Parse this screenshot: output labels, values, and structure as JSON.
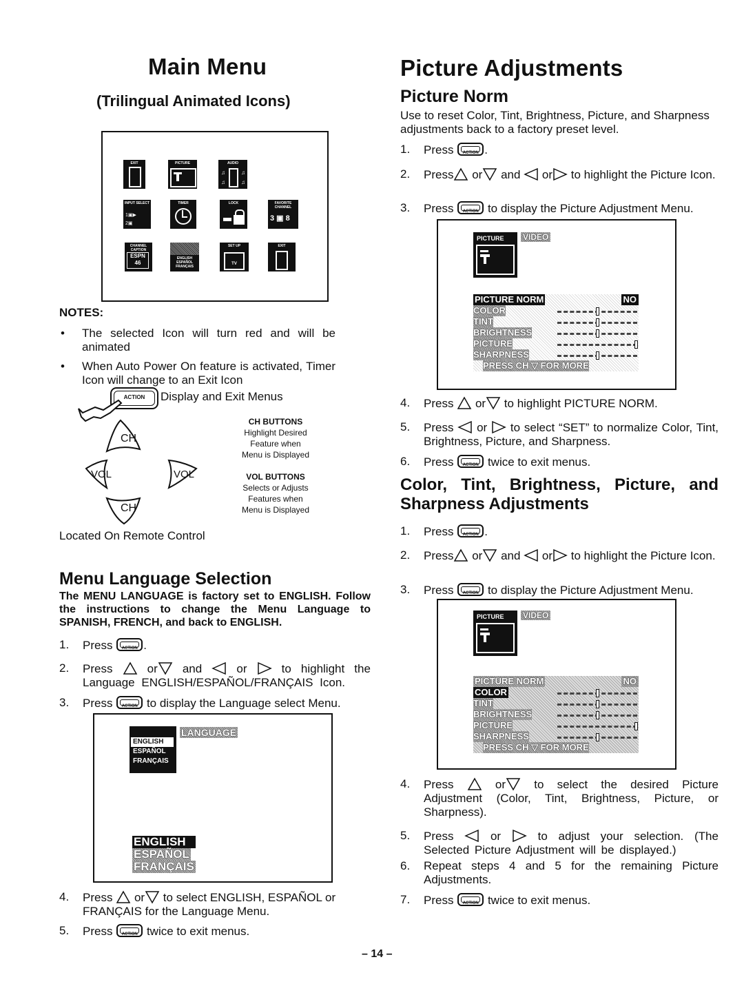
{
  "left": {
    "title": "Main Menu",
    "subtitle": "(Trilingual Animated Icons)",
    "icons": [
      {
        "label": "EXIT"
      },
      {
        "label": "PICTURE"
      },
      {
        "label": "AUDIO"
      },
      {
        "label": "INPUT SELECT"
      },
      {
        "label": "TIMER"
      },
      {
        "label": "LOCK"
      },
      {
        "label": "FAVORITE CHANNEL"
      },
      {
        "label": "CHANNEL CAPTION",
        "sub": "ESPN 46"
      },
      {
        "label": "ENGLISH ESPAÑOL FRANÇAIS"
      },
      {
        "label": "SET UP",
        "sub": "TV"
      },
      {
        "label": "EXIT"
      }
    ],
    "notes_heading": "NOTES:",
    "notes": [
      "The selected Icon will turn red and will be animated",
      "When Auto Power On feature is activated, Timer Icon will change to an Exit Icon"
    ],
    "action_label": "ACTION",
    "action_desc": "Display and Exit Menus",
    "ch_label": "CH",
    "vol_label": "VOL",
    "ch_buttons_title": "CH BUTTONS",
    "ch_buttons_desc": [
      "Highlight Desired",
      "Feature when",
      "Menu is Displayed"
    ],
    "vol_buttons_title": "VOL BUTTONS",
    "vol_buttons_desc": [
      "Selects or Adjusts",
      "Features when",
      "Menu is Displayed"
    ],
    "remote_caption": "Located On Remote Control",
    "lang_title": "Menu Language Selection",
    "lang_intro": "The MENU LANGUAGE is factory set to ENGLISH. Follow the instructions to change the Menu Language to SPANISH, FRENCH, and back to ENGLISH.",
    "lang_steps": {
      "s1_num": "1.",
      "s1_pre": "Press",
      "s1_post": ".",
      "s2_num": "2.",
      "s2_pre": "Press",
      "s2_or1": "or",
      "s2_and": "and",
      "s2_or2": "or",
      "s2_post": "to highlight the Language ENGLISH/ESPAÑOL/FRANÇAIS Icon.",
      "s3_num": "3.",
      "s3_pre": "Press",
      "s3_post": "to display the Language select Menu.",
      "s4_num": "4.",
      "s4_pre": "Press",
      "s4_or": "or",
      "s4_post": "to select ENGLISH, ESPAÑOL or FRANÇAIS for the Language Menu.",
      "s5_num": "5.",
      "s5_pre": "Press",
      "s5_post": "twice to exit menus."
    },
    "lang_screen": {
      "menu_items": [
        "ENGLISH",
        "ESPAÑOL",
        "FRANÇAIS"
      ],
      "header": "LANGUAGE",
      "list": [
        "ENGLISH",
        "ESPAÑOL",
        "FRANÇAIS"
      ]
    }
  },
  "right": {
    "title": "Picture Adjustments",
    "norm_title": "Picture Norm",
    "norm_intro": "Use to reset Color, Tint, Brightness, Picture, and Sharpness adjustments back to a factory preset level.",
    "norm_steps": {
      "s1_num": "1.",
      "s1_pre": "Press",
      "s1_post": ".",
      "s2_num": "2.",
      "s2_pre": "Press",
      "s2_or1": "or",
      "s2_and": "and",
      "s2_or2": "or",
      "s2_post": "to highlight the Picture Icon.",
      "s3_num": "3.",
      "s3_pre": "Press",
      "s3_post": "to display the Picture Adjustment Menu.",
      "s4_num": "4.",
      "s4_pre": "Press",
      "s4_or": "or",
      "s4_post": "to highlight PICTURE NORM.",
      "s5_num": "5.",
      "s5_pre": "Press",
      "s5_or": "or",
      "s5_post": "to select “SET” to normalize Color, Tint, Brightness, Picture, and Sharpness.",
      "s6_num": "6.",
      "s6_pre": "Press",
      "s6_post": "twice to exit menus."
    },
    "adj_title": "Color, Tint, Brightness, Picture, and Sharpness Adjustments",
    "adj_steps": {
      "s1_num": "1.",
      "s1_pre": "Press",
      "s1_post": ".",
      "s2_num": "2.",
      "s2_pre": "Press",
      "s2_or1": "or",
      "s2_and": "and",
      "s2_or2": "or",
      "s2_post": "to highlight the Picture Icon.",
      "s3_num": "3.",
      "s3_pre": "Press",
      "s3_post": "to display the Picture Adjustment Menu.",
      "s4_num": "4.",
      "s4_pre": "Press",
      "s4_or": "or",
      "s4_post": "to select the desired Picture Adjustment (Color, Tint, Brightness, Picture, or Sharpness).",
      "s5_num": "5.",
      "s5_pre": "Press",
      "s5_or": "or",
      "s5_post": "to adjust your selection. (The Selected Picture Adjustment will be displayed.)",
      "s6_num": "6.",
      "s6_text": "Repeat steps 4 and 5 for the remaining Picture Adjustments.",
      "s7_num": "7.",
      "s7_pre": "Press",
      "s7_post": "twice to exit menus."
    },
    "osd1": {
      "tab_picture": "PICTURE",
      "tab_video": "VIDEO",
      "rows": [
        {
          "label": "PICTURE NORM",
          "value": "NO",
          "highlight": true
        },
        {
          "label": "COLOR",
          "level": 0.5
        },
        {
          "label": "TINT",
          "level": 0.5
        },
        {
          "label": "BRIGHTNESS",
          "level": 0.5
        },
        {
          "label": "PICTURE",
          "level": 1.0
        },
        {
          "label": "SHARPNESS",
          "level": 0.5
        }
      ],
      "footer": "PRESS CH ▽ FOR MORE"
    },
    "osd2": {
      "tab_picture": "PICTURE",
      "tab_video": "VIDEO",
      "rows": [
        {
          "label": "PICTURE NORM",
          "value": "NO"
        },
        {
          "label": "COLOR",
          "level": 0.5,
          "highlight": true
        },
        {
          "label": "TINT",
          "level": 0.5
        },
        {
          "label": "BRIGHTNESS",
          "level": 0.5
        },
        {
          "label": "PICTURE",
          "level": 1.0
        },
        {
          "label": "SHARPNESS",
          "level": 0.5
        }
      ],
      "footer": "PRESS CH ▽ FOR MORE"
    }
  },
  "page_number": "– 14 –"
}
